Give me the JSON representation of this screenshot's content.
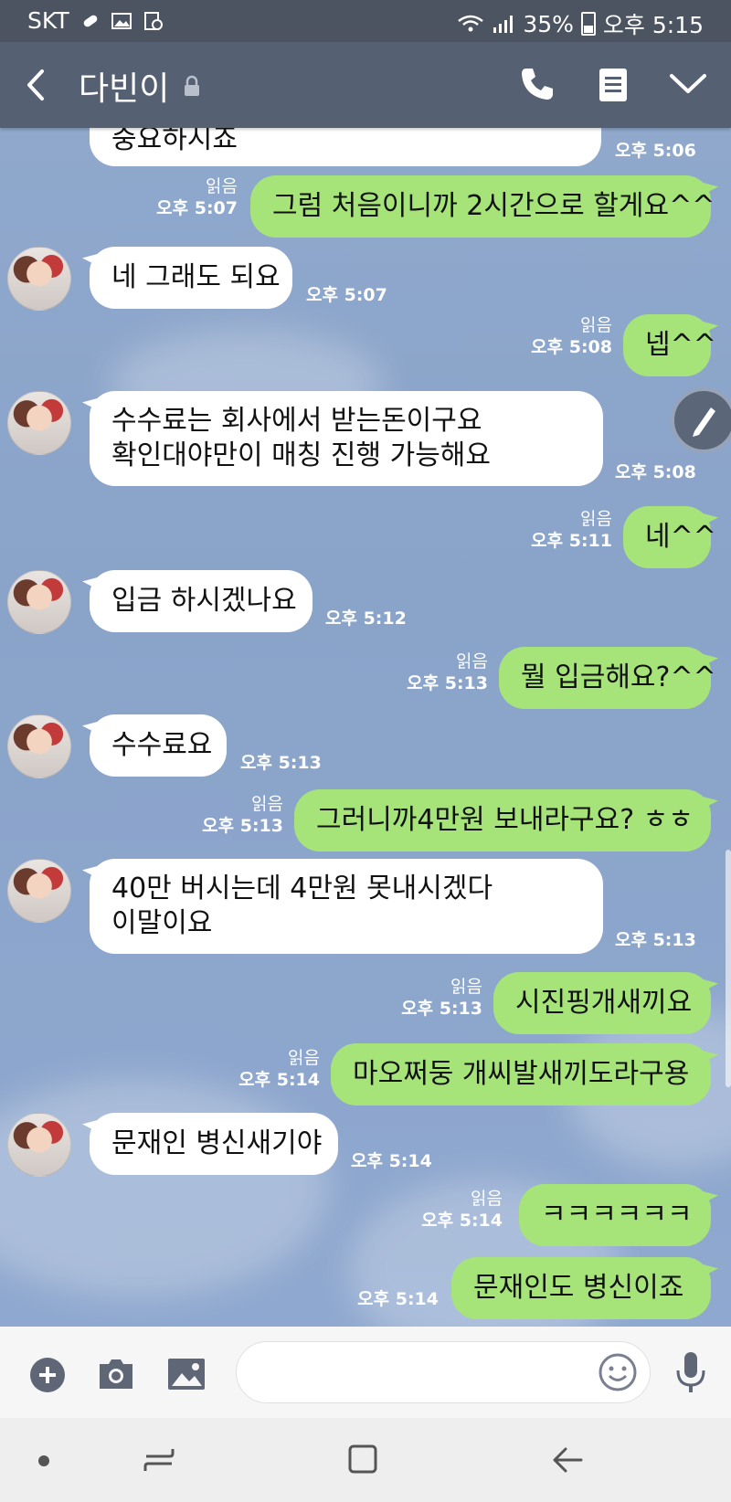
{
  "status_bar": {
    "carrier": "SKT",
    "battery": "35%",
    "time": "오후 5:15"
  },
  "header": {
    "title": "다빈이"
  },
  "messages": [
    {
      "dir": "in",
      "text": "중요하시죠",
      "time": "오후 5:06"
    },
    {
      "dir": "out",
      "text": "그럼 처음이니까 2시간으로 할게요^^",
      "read": "읽음",
      "time": "오후 5:07"
    },
    {
      "dir": "in",
      "text": "네 그래도 되요",
      "time": "오후 5:07"
    },
    {
      "dir": "out",
      "text": "넵^^",
      "read": "읽음",
      "time": "오후 5:08"
    },
    {
      "dir": "in",
      "lines": [
        "수수료는 회사에서 받는돈이구요",
        "확인대야만이 매칭 진행 가능해요"
      ],
      "time": "오후 5:08"
    },
    {
      "dir": "out",
      "text": "네^^",
      "read": "읽음",
      "time": "오후 5:11"
    },
    {
      "dir": "in",
      "text": "입금 하시겠나요",
      "time": "오후 5:12"
    },
    {
      "dir": "out",
      "text": "뭘 입금해요?^^",
      "read": "읽음",
      "time": "오후 5:13"
    },
    {
      "dir": "in",
      "text": "수수료요",
      "time": "오후 5:13"
    },
    {
      "dir": "out",
      "text": "그러니까4만원 보내라구요? ㅎㅎ",
      "read": "읽음",
      "time": "오후 5:13"
    },
    {
      "dir": "in",
      "lines": [
        "40만 버시는데 4만원 못내시겠다",
        "이말이요"
      ],
      "time": "오후 5:13"
    },
    {
      "dir": "out",
      "text": "시진핑개새끼요",
      "read": "읽음",
      "time": "오후 5:13"
    },
    {
      "dir": "out",
      "text": "마오쩌둥 개씨발새끼도라구용",
      "read": "읽음",
      "time": "오후 5:14"
    },
    {
      "dir": "in",
      "text": "문재인 병신새기야",
      "time": "오후 5:14"
    },
    {
      "dir": "out",
      "text": "ㅋㅋㅋㅋㅋㅋ",
      "read": "읽음",
      "time": "오후 5:14"
    },
    {
      "dir": "out",
      "text": "문재인도 병신이죠",
      "time": "오후 5:14"
    }
  ],
  "input": {
    "placeholder": ""
  },
  "colors": {
    "header": "#566073",
    "status_bar": "#4d5461",
    "outgoing_bubble": "#a6e47a",
    "incoming_bubble": "#ffffff",
    "chat_background": "#8aa3c8"
  }
}
